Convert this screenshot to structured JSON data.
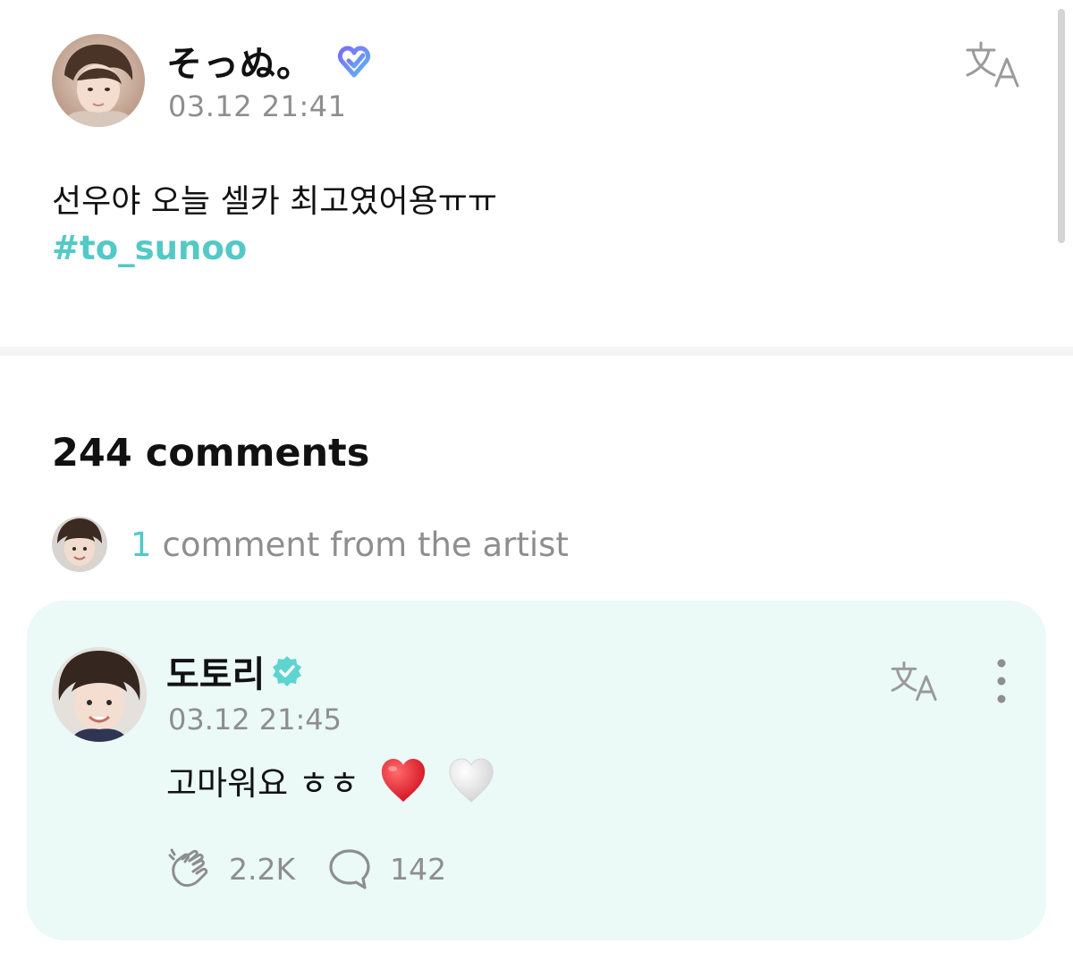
{
  "post": {
    "author": "そっぬ。",
    "timestamp": "03.12 21:41",
    "body": "선우야 오늘 셀카 최고였어용ㅠㅠ",
    "hashtag": "#to_sunoo",
    "membership_icon": "membership-badge-icon",
    "translate_icon": "translate-icon"
  },
  "comments": {
    "count_label": "244 comments",
    "artist_summary": {
      "count": "1",
      "text": "comment from the artist"
    },
    "artist_comment": {
      "author": "도토리",
      "verified_icon": "verified-badge-icon",
      "timestamp": "03.12 21:45",
      "text": "고마워요 ㅎㅎ",
      "emojis": [
        "red-heart-icon",
        "white-heart-icon"
      ],
      "likes": "2.2K",
      "replies": "142"
    }
  },
  "colors": {
    "accent": "#53c9c6",
    "card_background": "#ebf9f7",
    "secondary_text": "#8e8e8e",
    "membership_gradient_start": "#7b6cf6",
    "membership_gradient_end": "#5fb4f5"
  }
}
